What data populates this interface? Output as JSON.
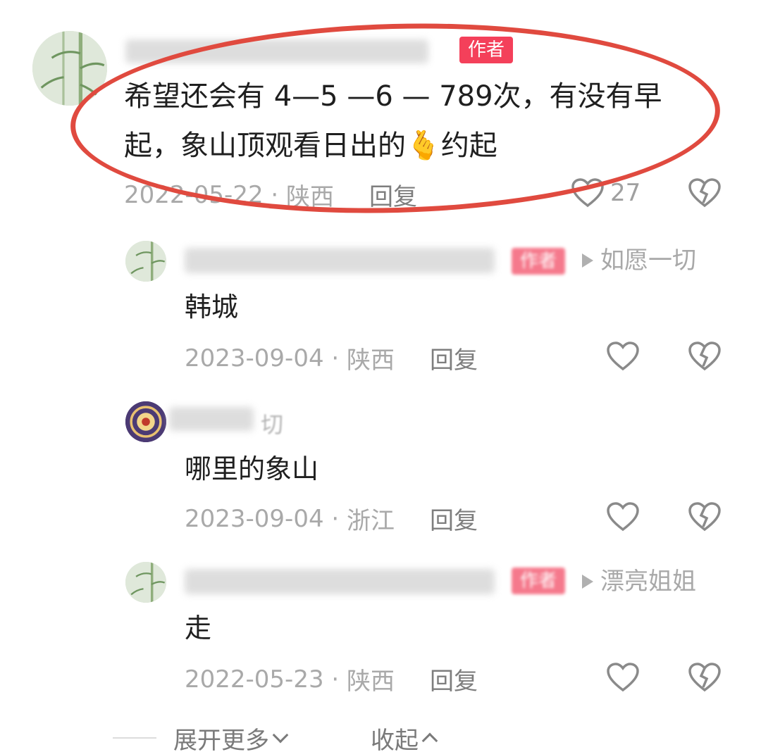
{
  "colors": {
    "accent": "#f4405a",
    "highlight": "#e04a3f",
    "meta": "#a9a9a9"
  },
  "main_comment": {
    "author_badge": "作者",
    "text_line1": "希望还会有 4—5 —6 — 789次，有没有早",
    "text_line2": "起，象山顶观看日出的",
    "emoji": "🫰",
    "text_line2_end": "约起",
    "date": "2022-05-22",
    "sep": "·",
    "location": "陕西",
    "reply_label": "回复",
    "like_count": "27"
  },
  "replies": [
    {
      "author_badge": "作者",
      "reply_to": "如愿一切",
      "text": "韩城",
      "date": "2023-09-04",
      "sep": "·",
      "location": "陕西",
      "reply_label": "回复"
    },
    {
      "name_fragment": "切",
      "text": "哪里的象山",
      "date": "2023-09-04",
      "sep": "·",
      "location": "浙江",
      "reply_label": "回复"
    },
    {
      "author_badge": "作者",
      "reply_to": "漂亮姐姐",
      "text": "走",
      "date": "2022-05-23",
      "sep": "·",
      "location": "陕西",
      "reply_label": "回复"
    }
  ],
  "footer": {
    "expand_label": "展开更多",
    "collapse_label": "收起"
  }
}
